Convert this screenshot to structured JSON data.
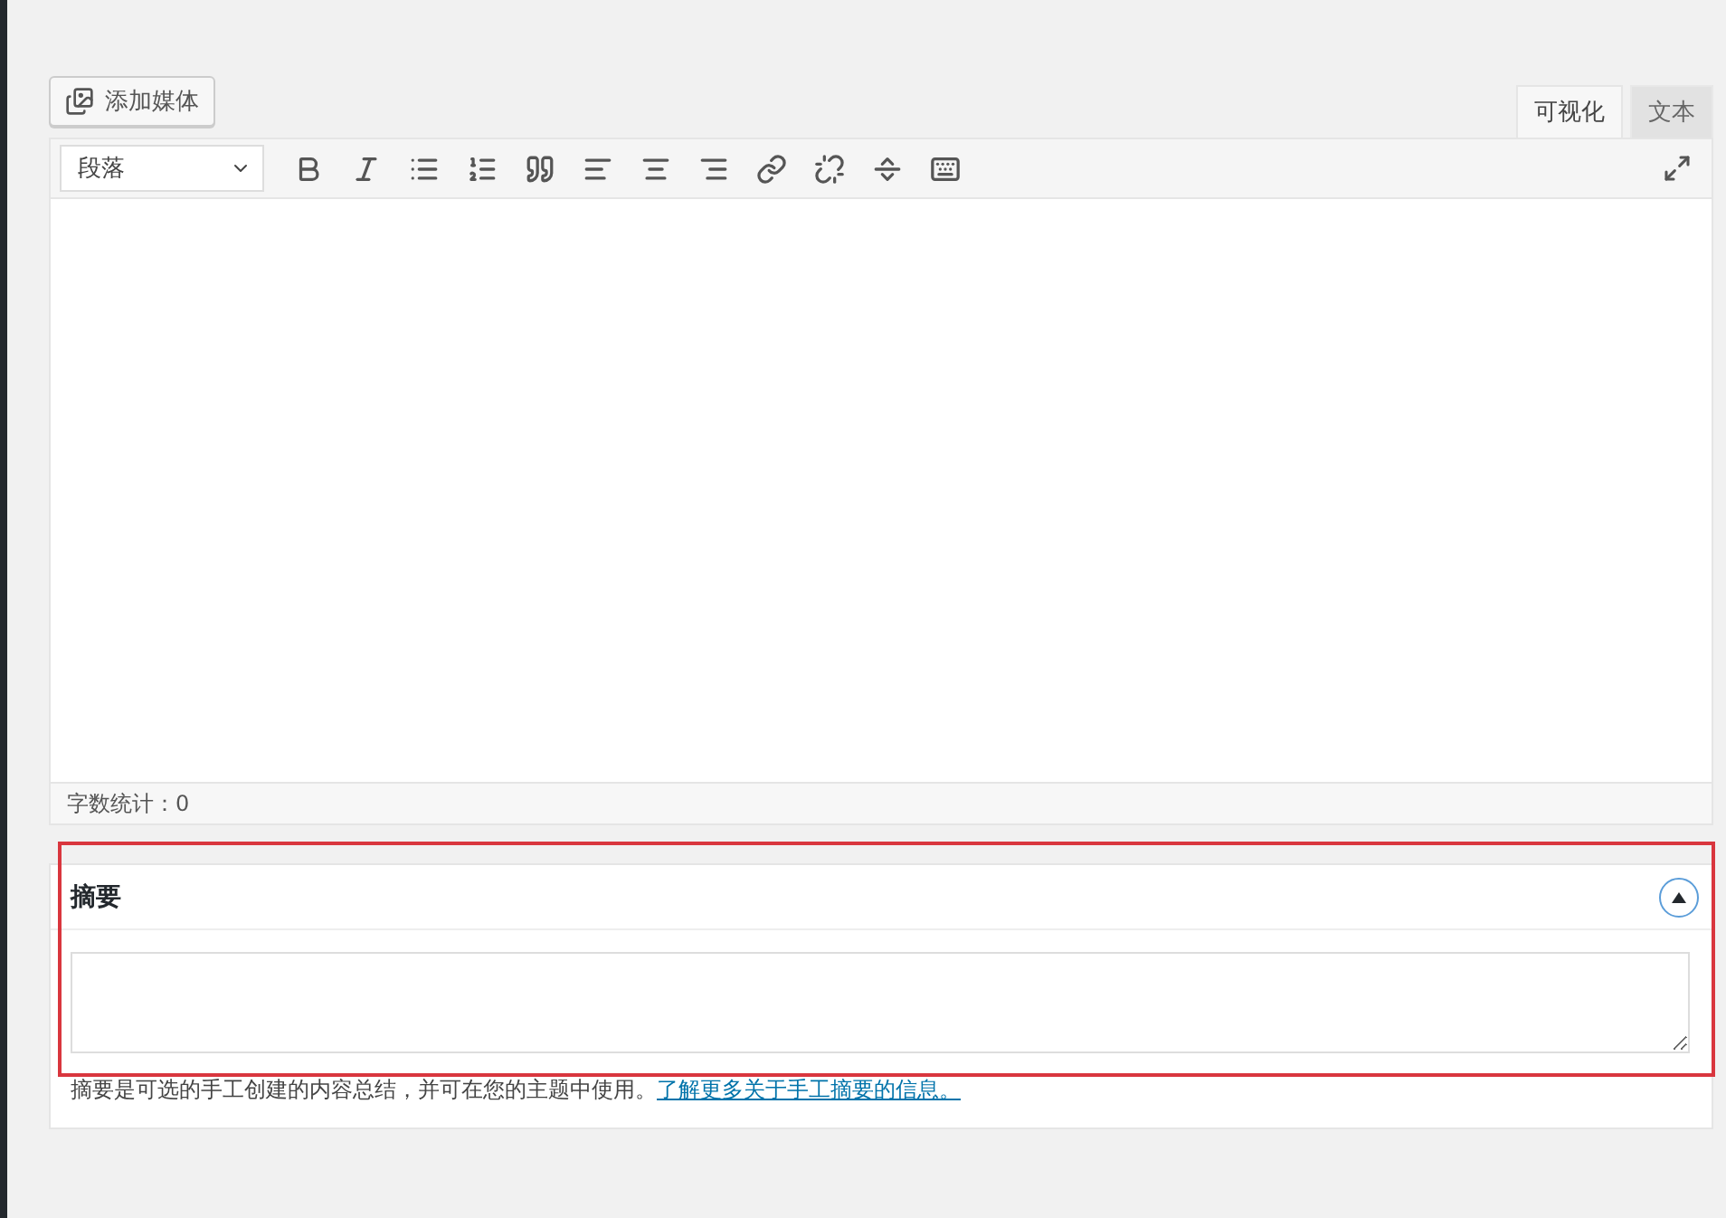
{
  "media_button": {
    "label": "添加媒体"
  },
  "editor_tabs": [
    {
      "label": "可视化",
      "selected": true
    },
    {
      "label": "文本",
      "selected": false
    }
  ],
  "format_select": {
    "value": "段落"
  },
  "word_count": {
    "label": "字数统计：",
    "value": "0"
  },
  "excerpt": {
    "title": "摘要",
    "expanded": true,
    "help": "摘要是可选的手工创建的内容总结，并可在您的主题中使用。",
    "link": "了解更多关于手工摘要的信息。"
  }
}
